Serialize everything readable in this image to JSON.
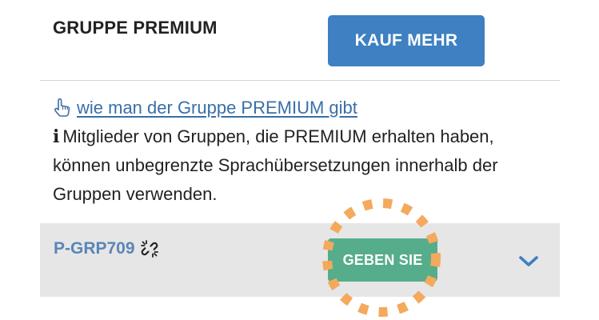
{
  "header": {
    "title": "GRUPPE PREMIUM",
    "buy_more_label": "KAUF MEHR"
  },
  "info": {
    "howto_link": "wie man der Gruppe PREMIUM gibt",
    "info_icon": "i",
    "description": "Mitglieder von Gruppen, die PREMIUM erhalten haben, können unbegrenzte Sprachübersetzungen innerhalb der Gruppen verwenden."
  },
  "group": {
    "id": "P-GRP709",
    "give_label": "GEBEN SIE"
  },
  "icons": {
    "howto": "hand-pointer-icon",
    "info": "info-icon",
    "group_status": "broken-link-icon",
    "expand": "chevron-down-icon"
  },
  "colors": {
    "primary_button": "#3e80c1",
    "give_button": "#56ad8b",
    "link": "#3a6fa8",
    "group_id": "#5a86b8",
    "row_background": "#e6e6e6",
    "highlight": "#f4a95c"
  }
}
